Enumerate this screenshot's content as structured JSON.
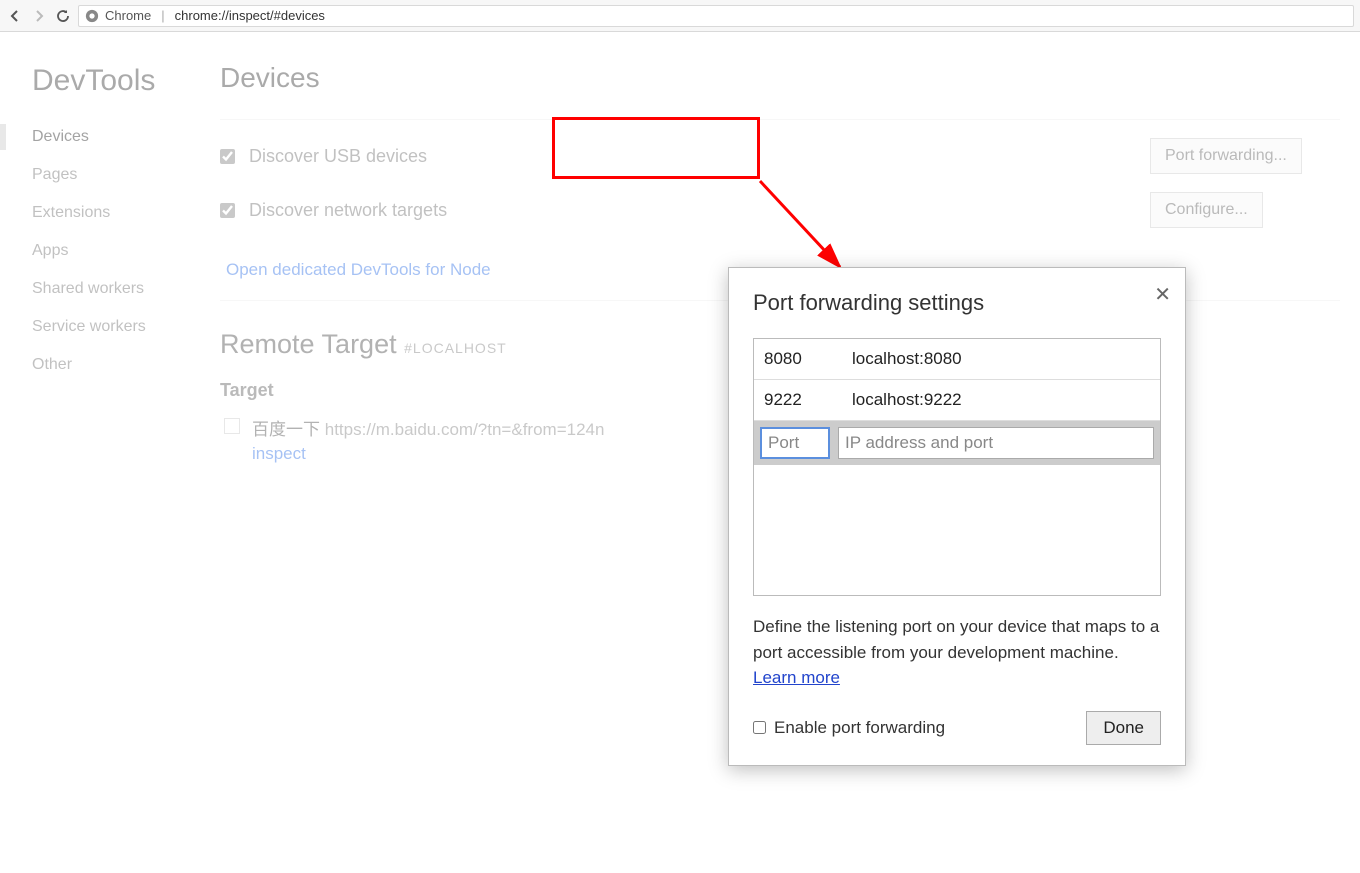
{
  "address_bar": {
    "scheme": "Chrome",
    "url": "chrome://inspect/#devices"
  },
  "sidebar": {
    "title": "DevTools",
    "items": [
      "Devices",
      "Pages",
      "Extensions",
      "Apps",
      "Shared workers",
      "Service workers",
      "Other"
    ]
  },
  "content": {
    "title": "Devices",
    "discover_usb": "Discover USB devices",
    "port_fwd_btn": "Port forwarding...",
    "discover_net": "Discover network targets",
    "configure_btn": "Configure...",
    "node_link": "Open dedicated DevTools for Node",
    "remote_title": "Remote Target",
    "remote_tag": "#LOCALHOST",
    "target_h": "Target",
    "target": {
      "name": "百度一下",
      "url": "https://m.baidu.com/?tn=&from=124n",
      "inspect": "inspect"
    }
  },
  "dialog": {
    "title": "Port forwarding settings",
    "rows": [
      {
        "port": "8080",
        "addr": "localhost:8080"
      },
      {
        "port": "9222",
        "addr": "localhost:9222"
      }
    ],
    "port_placeholder": "Port",
    "addr_placeholder": "IP address and port",
    "help": "Define the listening port on your device that maps to a port accessible from your development machine. ",
    "learn": "Learn more",
    "enable": "Enable port forwarding",
    "done": "Done"
  }
}
